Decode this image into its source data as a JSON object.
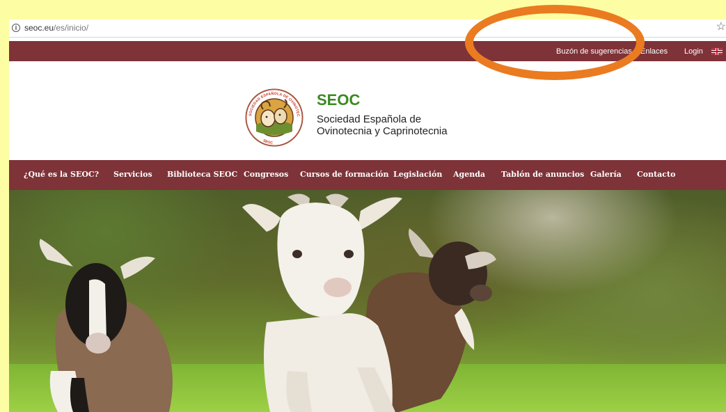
{
  "browser": {
    "url_domain": "seoc.eu",
    "url_path": "/es/inicio/",
    "icons": {
      "info": "info-icon",
      "bookmark": "star-icon"
    }
  },
  "topbar": {
    "links": [
      "Buzón de sugerencias",
      "Enlaces",
      "Login"
    ],
    "language_icon": "uk-flag-icon",
    "color": "#7e3338"
  },
  "header": {
    "brand_name": "SEOC",
    "brand_line1": "Sociedad Española de",
    "brand_line2": "Ovinotecnia y Caprinotecnia",
    "logo_text_top": "SOCIEDAD ESPAÑOLA DE OVINOTECNIA Y CAPRINOTECNIA",
    "brand_color": "#3a8a22"
  },
  "nav": {
    "items": [
      "¿Qué es la SEOC?",
      "Servicios",
      "Biblioteca SEOC",
      "Congresos",
      "Cursos de formación",
      "Legislación",
      "Agenda",
      "Tablón de anuncios",
      "Galería",
      "Contacto"
    ]
  },
  "hero": {
    "image": "three-young-goats-on-grass",
    "annotation_color": "#ea7b20"
  }
}
